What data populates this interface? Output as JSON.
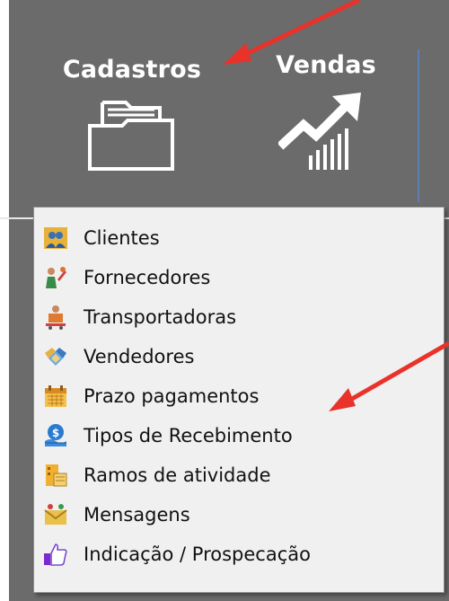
{
  "ribbon": {
    "buttons": [
      {
        "label": "Cadastros",
        "icon": "folder-icon"
      },
      {
        "label": "Vendas",
        "icon": "sales-chart-icon"
      }
    ]
  },
  "menu": {
    "items": [
      {
        "label": "Clientes",
        "icon": "clients-icon"
      },
      {
        "label": "Fornecedores",
        "icon": "suppliers-icon"
      },
      {
        "label": "Transportadoras",
        "icon": "carriers-icon"
      },
      {
        "label": "Vendedores",
        "icon": "sellers-icon"
      },
      {
        "label": "Prazo pagamentos",
        "icon": "calendar-icon"
      },
      {
        "label": "Tipos de Recebimento",
        "icon": "payment-types-icon"
      },
      {
        "label": "Ramos de atividade",
        "icon": "activity-branches-icon"
      },
      {
        "label": "Mensagens",
        "icon": "messages-icon"
      },
      {
        "label": "Indicação / Prospecação",
        "icon": "thumbs-up-icon"
      }
    ]
  },
  "colors": {
    "ribbon_bg": "#6b6b6b",
    "menu_bg": "#f0f0f0",
    "arrow": "#e8322a",
    "divider": "#5a7fb0"
  }
}
